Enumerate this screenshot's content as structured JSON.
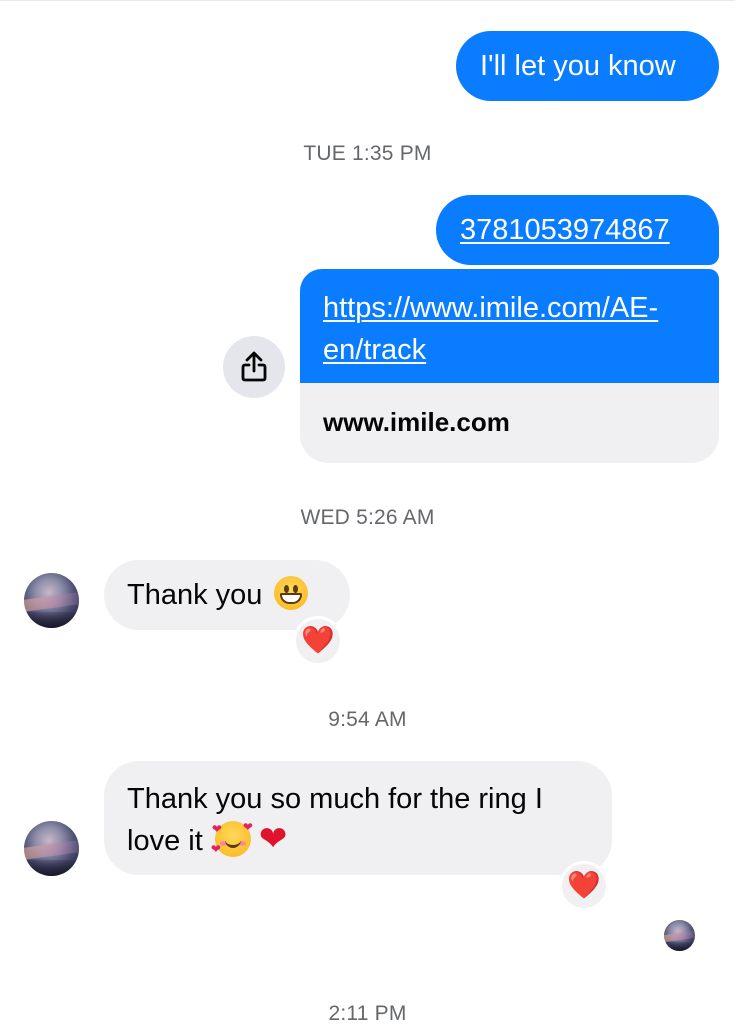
{
  "conversation": {
    "messages": [
      {
        "direction": "outgoing",
        "text": "I'll let you know"
      },
      {
        "direction": "outgoing",
        "text": "3781053974867",
        "is_link": true
      },
      {
        "direction": "outgoing",
        "link_url": "https://www.imile.com/AE-en/track",
        "link_domain": "www.imile.com"
      },
      {
        "direction": "incoming",
        "text": "Thank you",
        "emoji_name": "grinning-face-icon",
        "reaction": "❤️"
      },
      {
        "direction": "incoming",
        "text": "Thank you so much for the ring I love it",
        "emoji_name": "smiling-face-with-hearts-icon",
        "trailing_emoji": "❤",
        "reaction": "❤️"
      }
    ],
    "timestamps": [
      "TUE 1:35 PM",
      "WED 5:26 AM",
      "9:54 AM",
      "2:11 PM"
    ],
    "link_line_1": "https://www.imile.com/AE-",
    "link_line_2": "en/track",
    "message_4_line_1": "Thank you so much for the ring I",
    "message_4_line_2": "love it",
    "share_icon": "share-icon"
  },
  "colors": {
    "outgoing_bubble": "#0a7cff",
    "incoming_bubble": "#f0f0f2",
    "timestamp_text": "#65676b",
    "reaction_heart": "#e0132d"
  }
}
